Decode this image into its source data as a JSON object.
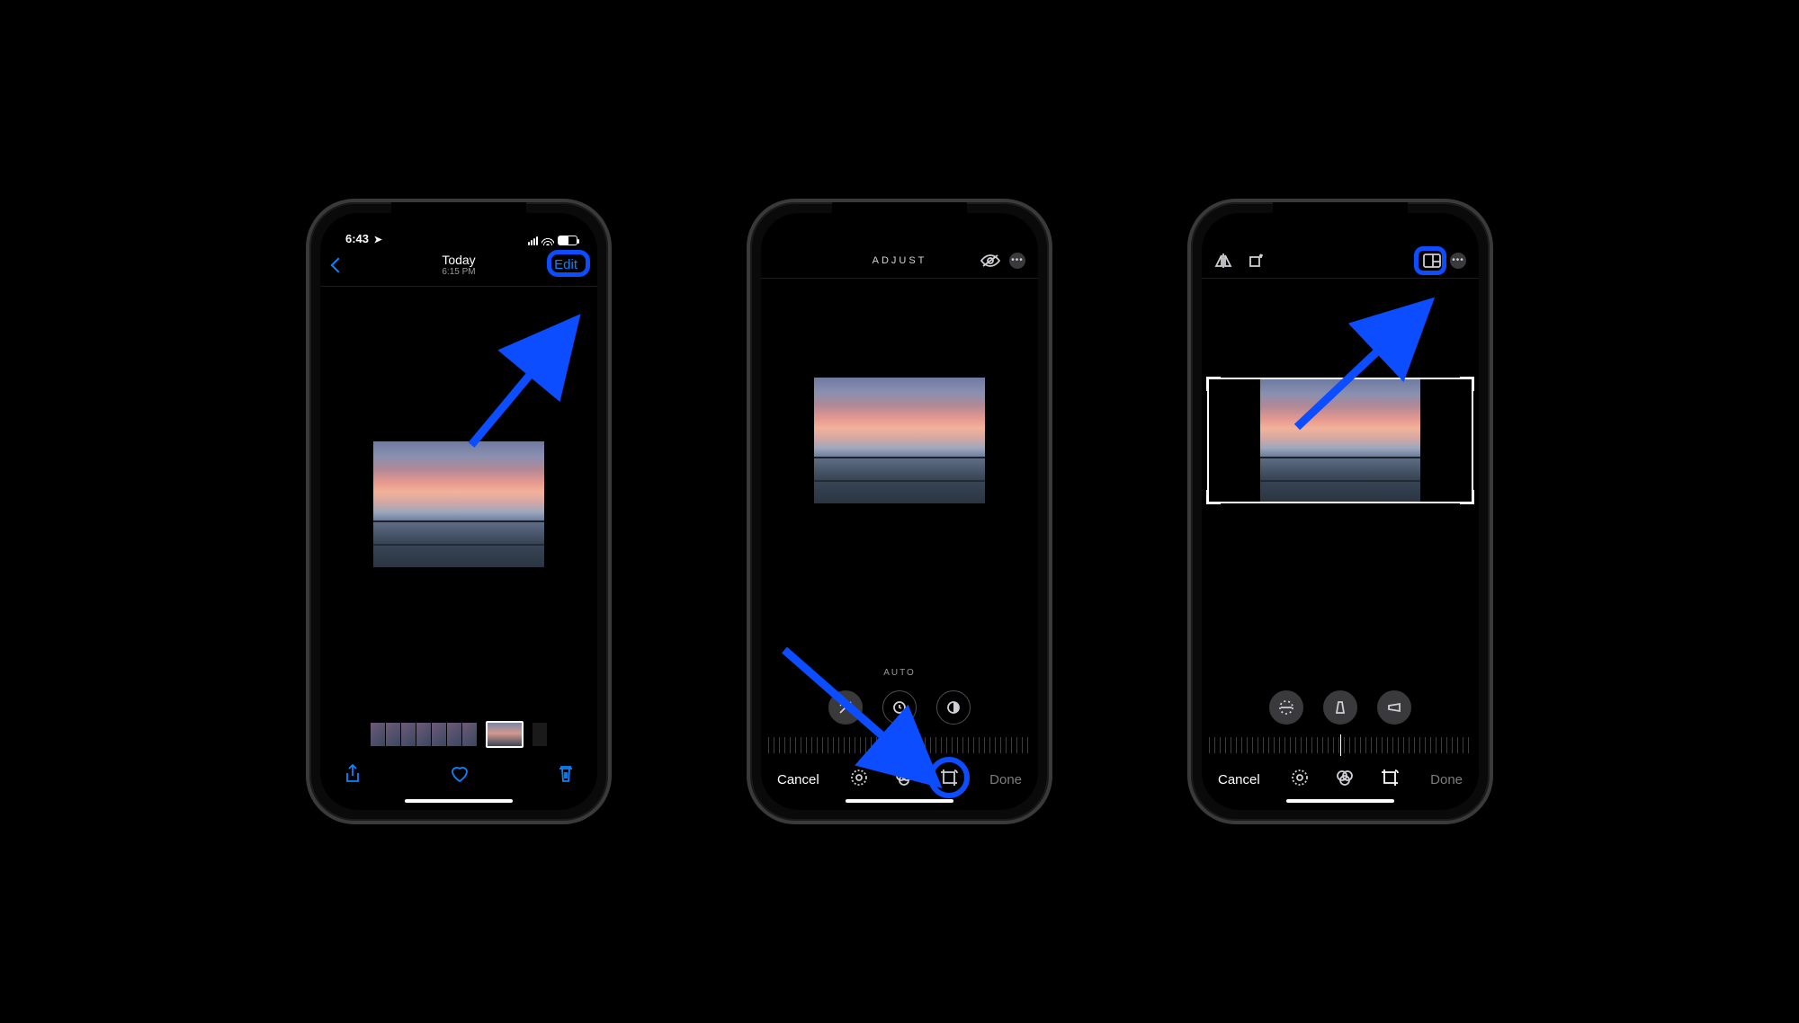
{
  "phone1": {
    "status": {
      "time": "6:43",
      "location_arrow": "➤"
    },
    "header": {
      "title": "Today",
      "subtitle": "6:15 PM",
      "edit": "Edit"
    }
  },
  "phone2": {
    "header": {
      "mode": "ADJUST"
    },
    "auto_label": "AUTO",
    "bottom": {
      "cancel": "Cancel",
      "done": "Done"
    }
  },
  "phone3": {
    "bottom": {
      "cancel": "Cancel",
      "done": "Done"
    }
  }
}
